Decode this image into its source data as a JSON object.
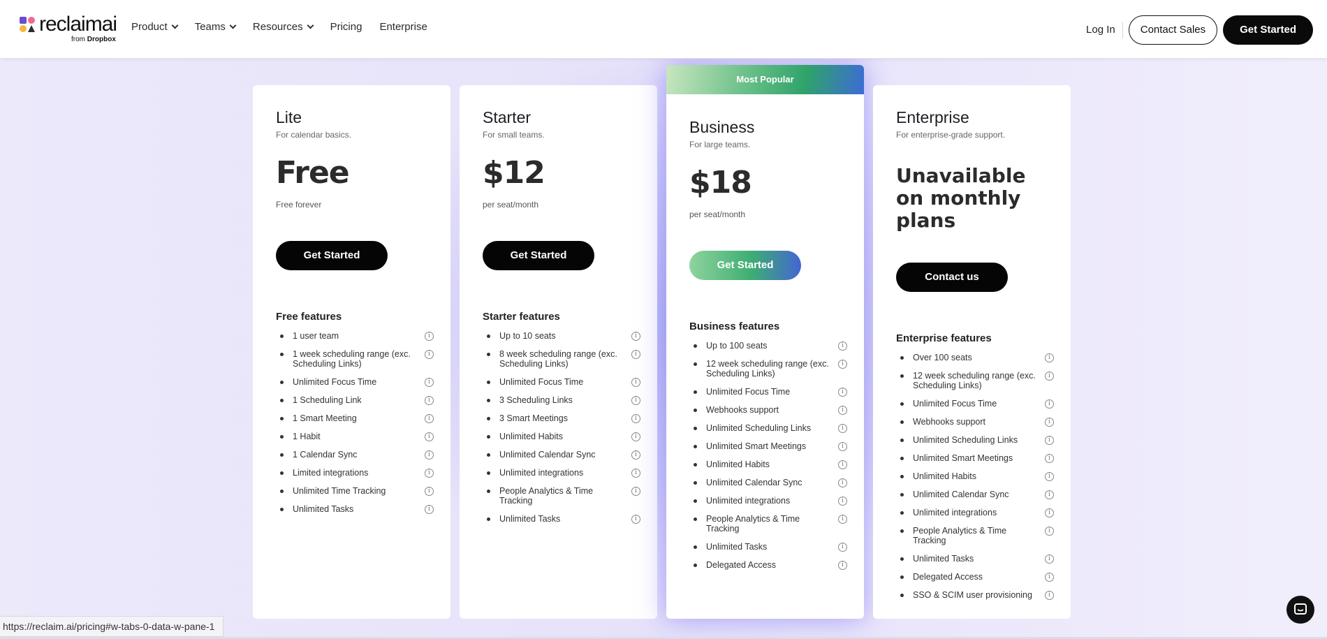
{
  "logo": {
    "word": "reclaimai",
    "sub_prefix": "from",
    "sub_brand": "Dropbox"
  },
  "nav": {
    "menu": [
      {
        "label": "Product",
        "has_chevron": true
      },
      {
        "label": "Teams",
        "has_chevron": true
      },
      {
        "label": "Resources",
        "has_chevron": true
      },
      {
        "label": "Pricing",
        "has_chevron": false
      },
      {
        "label": "Enterprise",
        "has_chevron": false
      }
    ],
    "login": "Log In",
    "contact_sales": "Contact Sales",
    "get_started": "Get Started"
  },
  "plans": [
    {
      "name": "Lite",
      "subtitle": "For calendar basics.",
      "price": "Free",
      "price_note": "Free forever",
      "cta": "Get Started",
      "features_title": "Free features",
      "features": [
        "1 user team",
        "1 week scheduling range (exc. Scheduling Links)",
        "Unlimited Focus Time",
        "1 Scheduling Link",
        "1 Smart Meeting",
        "1 Habit",
        "1 Calendar Sync",
        "Limited integrations",
        "Unlimited Time Tracking",
        "Unlimited Tasks"
      ]
    },
    {
      "name": "Starter",
      "subtitle": "For small teams.",
      "price": "$12",
      "price_note": "per seat/month",
      "cta": "Get Started",
      "features_title": "Starter features",
      "features": [
        "Up to 10 seats",
        "8 week scheduling range (exc. Scheduling Links)",
        "Unlimited Focus Time",
        "3 Scheduling Links",
        "3 Smart Meetings",
        "Unlimited Habits",
        "Unlimited Calendar Sync",
        "Unlimited integrations",
        "People Analytics & Time Tracking",
        "Unlimited Tasks"
      ]
    },
    {
      "name": "Business",
      "subtitle": "For large teams.",
      "badge": "Most Popular",
      "price": "$18",
      "price_note": "per seat/month",
      "cta": "Get Started",
      "features_title": "Business features",
      "features": [
        "Up to 100 seats",
        "12 week scheduling range (exc. Scheduling Links)",
        "Unlimited Focus Time",
        "Webhooks support",
        "Unlimited Scheduling Links",
        "Unlimited Smart Meetings",
        "Unlimited Habits",
        "Unlimited Calendar Sync",
        "Unlimited integrations",
        "People Analytics & Time Tracking",
        "Unlimited Tasks",
        "Delegated Access"
      ]
    },
    {
      "name": "Enterprise",
      "subtitle": "For enterprise-grade support.",
      "price": "Unavailable on monthly plans",
      "price_note": "",
      "cta": "Contact us",
      "features_title": "Enterprise features",
      "features": [
        "Over 100 seats",
        "12 week scheduling range (exc. Scheduling Links)",
        "Unlimited Focus Time",
        "Webhooks support",
        "Unlimited Scheduling Links",
        "Unlimited Smart Meetings",
        "Unlimited Habits",
        "Unlimited Calendar Sync",
        "Unlimited integrations",
        "People Analytics & Time Tracking",
        "Unlimited Tasks",
        "Delegated Access",
        "SSO & SCIM user provisioning"
      ]
    }
  ],
  "status_url": "https://reclaim.ai/pricing#w-tabs-0-data-w-pane-1",
  "colors": {
    "accent_black": "#0a0a0a",
    "popular_green": "#2fa36a",
    "popular_blue": "#3d6bd6",
    "background": "#ece9fb"
  },
  "icons": {
    "info": "info-circle-icon",
    "chat": "chat-bubble-icon",
    "chevron": "chevron-down-icon"
  }
}
